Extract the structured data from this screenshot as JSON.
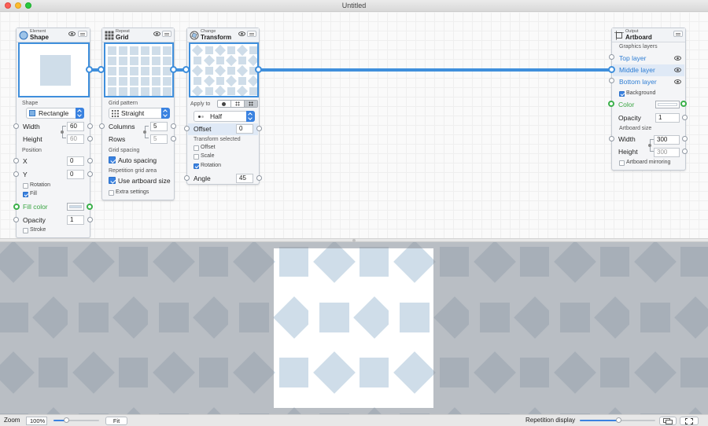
{
  "window": {
    "title": "Untitled"
  },
  "nodes": {
    "shape": {
      "kind": "Element",
      "title": "Shape",
      "shape_section": "Shape",
      "shape_value": "Rectangle",
      "width_label": "Width",
      "width_value": "60",
      "height_label": "Height",
      "height_value": "60",
      "position_section": "Position",
      "x_label": "X",
      "x_value": "0",
      "y_label": "Y",
      "y_value": "0",
      "rotation_label": "Rotation",
      "rotation_checked": false,
      "fill_label": "Fill",
      "fill_checked": true,
      "fill_color_label": "Fill color",
      "opacity_label": "Opacity",
      "opacity_value": "1",
      "stroke_label": "Stroke",
      "stroke_checked": false
    },
    "grid": {
      "kind": "Repeat",
      "title": "Grid",
      "pattern_section": "Grid pattern",
      "pattern_value": "Straight",
      "columns_label": "Columns",
      "columns_value": "5",
      "rows_label": "Rows",
      "rows_value": "5",
      "spacing_section": "Grid spacing",
      "auto_spacing_label": "Auto spacing",
      "auto_spacing_checked": true,
      "area_section": "Repetition grid area",
      "use_artboard_label": "Use artboard size",
      "use_artboard_checked": true,
      "extra_label": "Extra settings",
      "extra_checked": false
    },
    "transform": {
      "kind": "Change",
      "title": "Transform",
      "apply_to_label": "Apply to",
      "mode_value": "Half",
      "offset_label": "Offset",
      "offset_value": "0",
      "selected_section": "Transform selected",
      "offset_check_label": "Offset",
      "offset_checked": false,
      "scale_check_label": "Scale",
      "scale_checked": false,
      "rotation_check_label": "Rotation",
      "rotation_checked": true,
      "angle_label": "Angle",
      "angle_value": "45"
    },
    "artboard": {
      "kind": "Output",
      "title": "Artboard",
      "layers_section": "Graphics layers",
      "layers": [
        {
          "label": "Top layer",
          "highlight": false
        },
        {
          "label": "Middle layer",
          "highlight": true
        },
        {
          "label": "Bottom layer",
          "highlight": false
        }
      ],
      "background_label": "Background",
      "background_checked": true,
      "color_label": "Color",
      "opacity_label": "Opacity",
      "opacity_value": "1",
      "size_section": "Artboard size",
      "width_label": "Width",
      "width_value": "300",
      "height_label": "Height",
      "height_value": "300",
      "mirroring_label": "Artboard mirroring",
      "mirroring_checked": false
    }
  },
  "colors": {
    "accent": "#3f8fdc",
    "shape_fill": "#cfdde9",
    "outside_bg": "#b9bec4",
    "outside_shape": "#a7afb8",
    "artboard_bg": "#ffffff",
    "green_port": "#3bb04a"
  },
  "statusbar": {
    "zoom_label": "Zoom",
    "zoom_value": "100%",
    "fit_label": "Fit",
    "zoom_fraction": 0.3,
    "repetition_label": "Repetition display",
    "repetition_fraction": 0.52
  }
}
